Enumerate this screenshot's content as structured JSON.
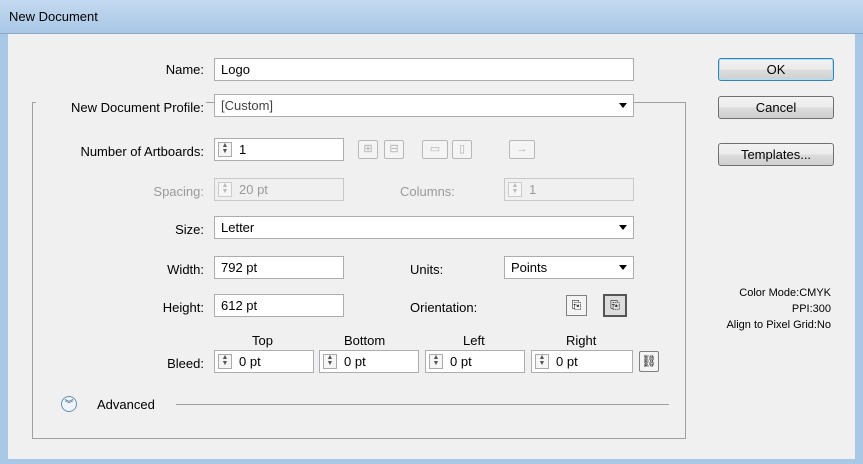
{
  "window": {
    "title": "New Document"
  },
  "fields": {
    "name": {
      "label": "Name:",
      "value": "Logo"
    },
    "profile": {
      "label": "New Document Profile:",
      "value": "[Custom]"
    },
    "artboards": {
      "label": "Number of Artboards:",
      "value": "1"
    },
    "spacing": {
      "label": "Spacing:",
      "value": "20 pt"
    },
    "columns": {
      "label": "Columns:",
      "value": "1"
    },
    "size": {
      "label": "Size:",
      "value": "Letter"
    },
    "width": {
      "label": "Width:",
      "value": "792 pt"
    },
    "units": {
      "label": "Units:",
      "value": "Points"
    },
    "height": {
      "label": "Height:",
      "value": "612 pt"
    },
    "orientation": {
      "label": "Orientation:",
      "selected": "landscape"
    }
  },
  "bleed": {
    "label": "Bleed:",
    "headers": [
      "Top",
      "Bottom",
      "Left",
      "Right"
    ],
    "values": [
      "0 pt",
      "0 pt",
      "0 pt",
      "0 pt"
    ]
  },
  "advanced": {
    "label": "Advanced"
  },
  "buttons": {
    "ok": "OK",
    "cancel": "Cancel",
    "templates": "Templates..."
  },
  "info": {
    "color_mode": "Color Mode:CMYK",
    "ppi": "PPI:300",
    "pixel_grid": "Align to Pixel Grid:No"
  },
  "icons": {
    "artboard_layout": [
      "grid-by-row-icon",
      "grid-by-column-icon",
      "arrange-by-row-icon",
      "arrange-by-column-icon"
    ],
    "layout_direction": "arrow-right-icon",
    "link_bleed": "chain-link-icon",
    "portrait": "portrait-icon",
    "landscape": "landscape-icon",
    "expand": "chevron-down-circle-icon"
  },
  "colors": {
    "titlebar": "#a9c8e6",
    "default_button_border": "#3c7fb1"
  }
}
